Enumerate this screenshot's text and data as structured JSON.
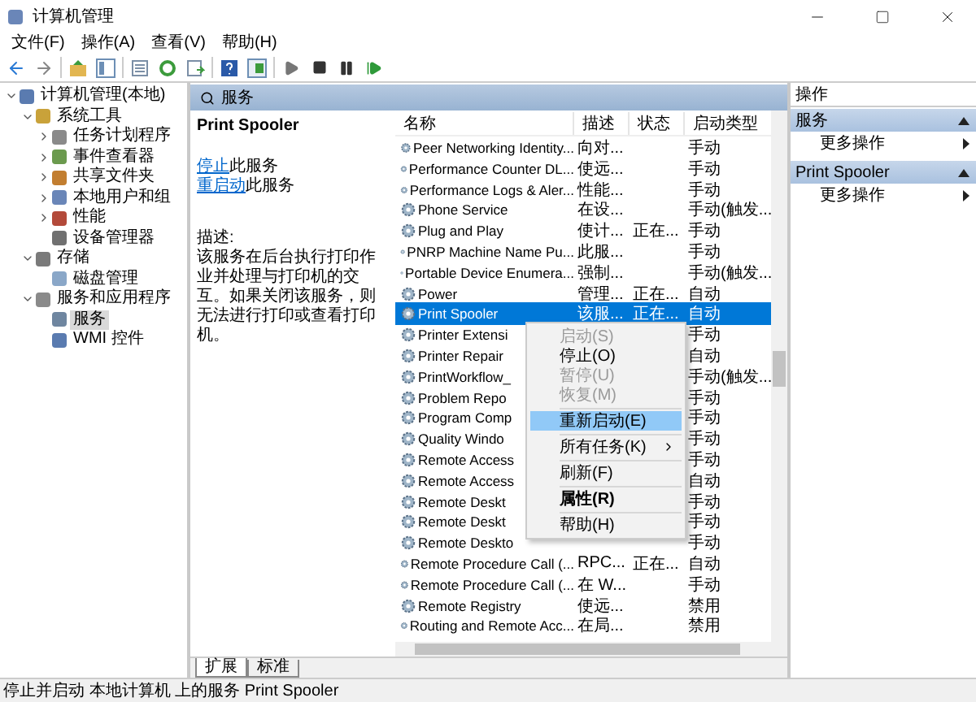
{
  "window": {
    "title": "计算机管理"
  },
  "menu": [
    "文件(F)",
    "操作(A)",
    "查看(V)",
    "帮助(H)"
  ],
  "tree": [
    {
      "label": "计算机管理(本地)",
      "expanded": true,
      "selected": false,
      "children": [
        {
          "label": "系统工具",
          "expanded": true,
          "selected": false,
          "children": [
            {
              "label": "任务计划程序",
              "expanded": false,
              "selected": false
            },
            {
              "label": "事件查看器",
              "expanded": false,
              "selected": false
            },
            {
              "label": "共享文件夹",
              "expanded": false,
              "selected": false
            },
            {
              "label": "本地用户和组",
              "expanded": false,
              "selected": false
            },
            {
              "label": "性能",
              "expanded": false,
              "selected": false
            },
            {
              "label": "设备管理器",
              "selected": false
            }
          ]
        },
        {
          "label": "存储",
          "expanded": true,
          "selected": false,
          "children": [
            {
              "label": "磁盘管理",
              "selected": false
            }
          ]
        },
        {
          "label": "服务和应用程序",
          "expanded": true,
          "selected": false,
          "children": [
            {
              "label": "服务",
              "selected": true
            },
            {
              "label": "WMI 控件",
              "selected": false
            }
          ]
        }
      ]
    }
  ],
  "panel": {
    "title": "服务"
  },
  "details": {
    "service": "Print Spooler",
    "actions": [
      {
        "link": "停止",
        "text": "此服务"
      },
      {
        "link": "重启动",
        "text": "此服务"
      }
    ],
    "description_label": "描述:",
    "description": "该服务在后台执行打印作业并处理与打印机的交互。如果关闭该服务，则无法进行打印或查看打印机。"
  },
  "table": {
    "columns": [
      "名称",
      "描述",
      "状态",
      "启动类型"
    ],
    "rows": [
      {
        "name": "Peer Networking Identity...",
        "desc": "向对...",
        "status": "",
        "startup": "手动",
        "selected": false
      },
      {
        "name": "Performance Counter DL...",
        "desc": "使远...",
        "status": "",
        "startup": "手动",
        "selected": false
      },
      {
        "name": "Performance Logs & Aler...",
        "desc": "性能...",
        "status": "",
        "startup": "手动",
        "selected": false
      },
      {
        "name": "Phone Service",
        "desc": "在设...",
        "status": "",
        "startup": "手动(触发...",
        "selected": false
      },
      {
        "name": "Plug and Play",
        "desc": "使计...",
        "status": "正在...",
        "startup": "手动",
        "selected": false
      },
      {
        "name": "PNRP Machine Name Pu...",
        "desc": "此服...",
        "status": "",
        "startup": "手动",
        "selected": false
      },
      {
        "name": "Portable Device Enumera...",
        "desc": "强制...",
        "status": "",
        "startup": "手动(触发...",
        "selected": false
      },
      {
        "name": "Power",
        "desc": "管理...",
        "status": "正在...",
        "startup": "自动",
        "selected": false
      },
      {
        "name": "Print Spooler",
        "desc": "该服...",
        "status": "正在...",
        "startup": "自动",
        "selected": true
      },
      {
        "name": "Printer Extensi",
        "desc": "",
        "status": "",
        "startup": "手动",
        "selected": false
      },
      {
        "name": "Printer Repair",
        "desc": "",
        "status": "",
        "startup": "自动",
        "selected": false
      },
      {
        "name": "PrintWorkflow_",
        "desc": "",
        "status": "",
        "startup": "手动(触发...",
        "selected": false
      },
      {
        "name": "Problem Repo",
        "desc": "",
        "status": "",
        "startup": "手动",
        "selected": false
      },
      {
        "name": "Program Comp",
        "desc": "",
        "status": "",
        "startup": "手动",
        "selected": false
      },
      {
        "name": "Quality Windo",
        "desc": "",
        "status": "",
        "startup": "手动",
        "selected": false
      },
      {
        "name": "Remote Access",
        "desc": "",
        "status": "",
        "startup": "手动",
        "selected": false
      },
      {
        "name": "Remote Access",
        "desc": "",
        "status": "",
        "startup": "自动",
        "selected": false
      },
      {
        "name": "Remote Deskt",
        "desc": "",
        "status": "",
        "startup": "手动",
        "selected": false
      },
      {
        "name": "Remote Deskt",
        "desc": "",
        "status": "",
        "startup": "手动",
        "selected": false
      },
      {
        "name": "Remote Deskto",
        "desc": "",
        "status": "",
        "startup": "手动",
        "selected": false
      },
      {
        "name": "Remote Procedure Call (...",
        "desc": "RPC...",
        "status": "正在...",
        "startup": "自动",
        "selected": false
      },
      {
        "name": "Remote Procedure Call (...",
        "desc": "在 W...",
        "status": "",
        "startup": "手动",
        "selected": false
      },
      {
        "name": "Remote Registry",
        "desc": "使远...",
        "status": "",
        "startup": "禁用",
        "selected": false
      },
      {
        "name": "Routing and Remote Acc...",
        "desc": "在局...",
        "status": "",
        "startup": "禁用",
        "selected": false
      }
    ]
  },
  "context_menu": [
    {
      "kind": "item",
      "label": "启动(S)",
      "disabled": true,
      "selected": false,
      "bold": false
    },
    {
      "kind": "item",
      "label": "停止(O)",
      "disabled": false,
      "selected": false,
      "bold": false
    },
    {
      "kind": "item",
      "label": "暂停(U)",
      "disabled": true,
      "selected": false,
      "bold": false
    },
    {
      "kind": "item",
      "label": "恢复(M)",
      "disabled": true,
      "selected": false,
      "bold": false
    },
    {
      "kind": "separator"
    },
    {
      "kind": "item",
      "label": "重新启动(E)",
      "disabled": false,
      "selected": true,
      "bold": false
    },
    {
      "kind": "separator"
    },
    {
      "kind": "submenu",
      "label": "所有任务(K)",
      "disabled": false,
      "selected": false,
      "bold": false
    },
    {
      "kind": "separator"
    },
    {
      "kind": "item",
      "label": "刷新(F)",
      "disabled": false,
      "selected": false,
      "bold": false
    },
    {
      "kind": "separator"
    },
    {
      "kind": "item",
      "label": "属性(R)",
      "disabled": false,
      "selected": false,
      "bold": true
    },
    {
      "kind": "separator"
    },
    {
      "kind": "item",
      "label": "帮助(H)",
      "disabled": false,
      "selected": false,
      "bold": false
    }
  ],
  "view_tabs": [
    {
      "label": "扩展",
      "selected": true
    },
    {
      "label": "标准",
      "selected": false
    }
  ],
  "actions_pane": {
    "title": "操作",
    "sections": [
      {
        "title": "服务",
        "items": [
          "更多操作"
        ]
      },
      {
        "title": "Print Spooler",
        "items": [
          "更多操作"
        ]
      }
    ]
  },
  "status_bar": "停止并启动 本地计算机 上的服务 Print Spooler"
}
